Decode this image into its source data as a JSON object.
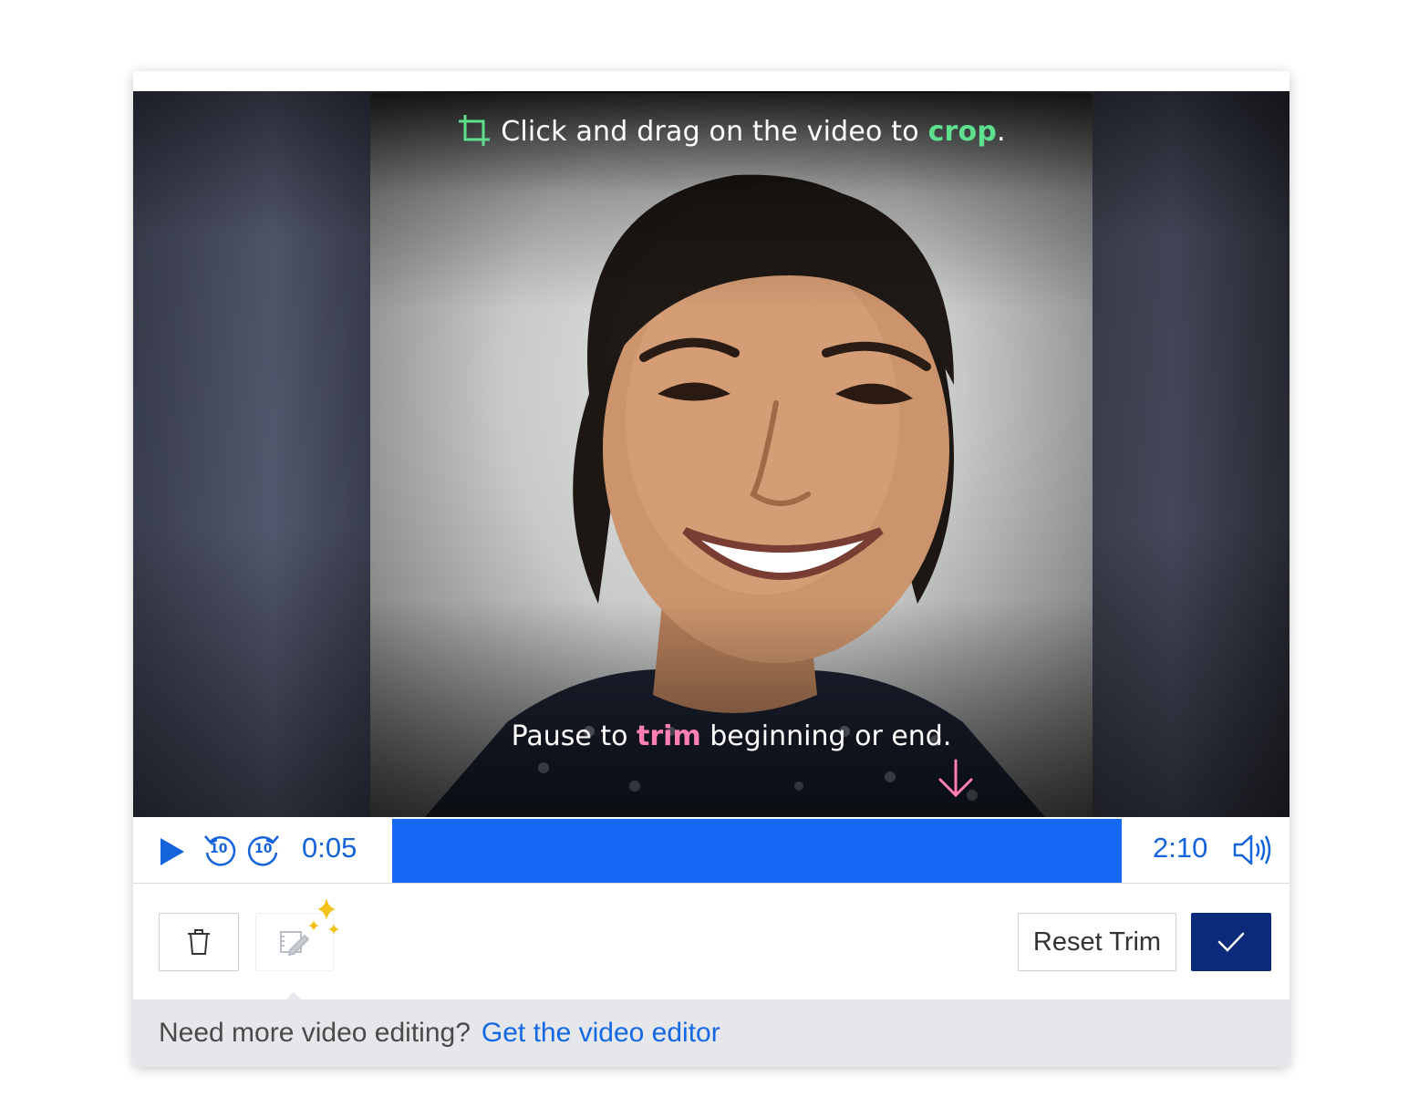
{
  "video": {
    "crop_hint": {
      "before": "Click and drag on the video to ",
      "accent": "crop",
      "after": "."
    },
    "trim_hint": {
      "before": "Pause to ",
      "accent": "trim",
      "after": " beginning or end."
    }
  },
  "controls": {
    "rewind_label": "10",
    "forward_label": "10",
    "current_time": "0:05",
    "duration": "2:10"
  },
  "toolbar": {
    "reset_trim_label": "Reset Trim"
  },
  "footer": {
    "prompt": "Need more video editing?",
    "link_label": "Get the video editor"
  },
  "colors": {
    "primary_blue": "#1668f5",
    "confirm_navy": "#0b2a7a",
    "crop_green": "#5ee08f",
    "trim_pink": "#ff7fb4",
    "sparkle_gold": "#f2c21b"
  }
}
